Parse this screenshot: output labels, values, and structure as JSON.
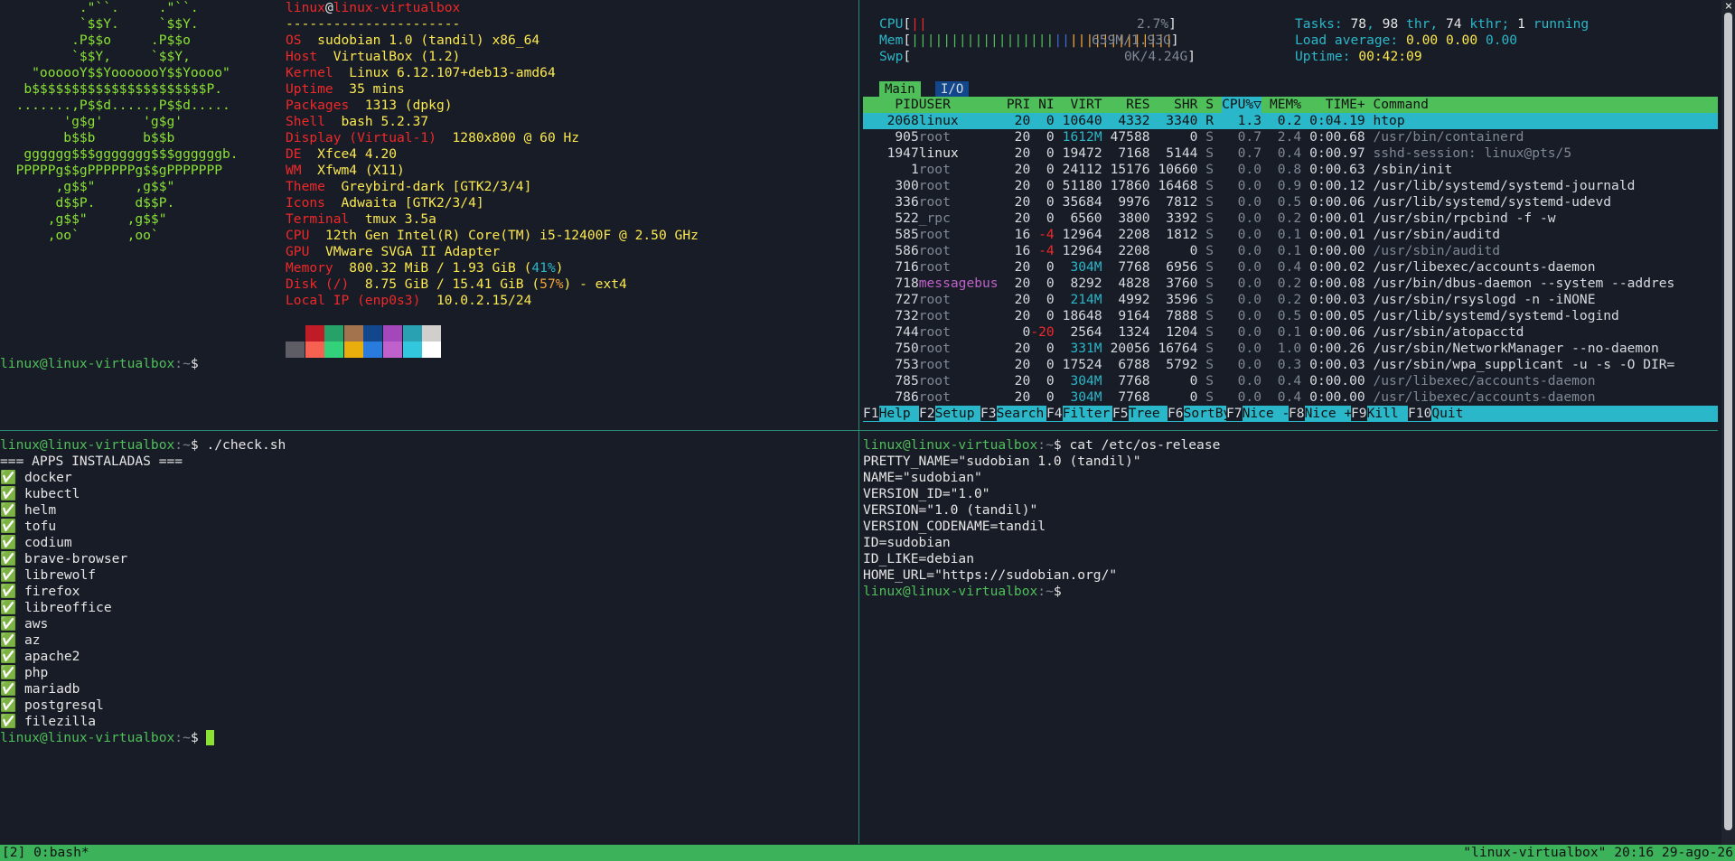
{
  "neofetch": {
    "logo": [
      "          .\"``.     .\"``.",
      "          `$$Y.     `$$Y.",
      "         .P$$o     .P$$o",
      "         `$$Y,     `$$Y,",
      "    \"oooooY$$YooooooY$$Yoooo\"",
      "   b$$$$$$$$$$$$$$$$$$$$$$P.",
      "  .......,P$$d.....,P$$d.....",
      "        'g$g'     'g$g'",
      "        b$$b      b$$b",
      "   gggggg$$$ggggggg$$$ggggggb.",
      "  PPPPPg$$gPPPPPPg$$gPPPPPPP",
      "       ,g$$\"     ,g$$\"",
      "       d$$P.     d$$P.",
      "      ,g$$\"     ,g$$\"",
      "      ,oo`      ,oo`"
    ],
    "user": "linux",
    "at": "@",
    "host": "linux-virtualbox",
    "separator": "----------------------",
    "fields": [
      {
        "key": "OS",
        "value": "sudobian 1.0 (tandil) x86_64"
      },
      {
        "key": "Host",
        "value": "VirtualBox (1.2)"
      },
      {
        "key": "Kernel",
        "value": "Linux 6.12.107+deb13-amd64"
      },
      {
        "key": "Uptime",
        "value": "35 mins"
      },
      {
        "key": "Packages",
        "value": "1313 (dpkg)"
      },
      {
        "key": "Shell",
        "value": "bash 5.2.37"
      },
      {
        "key": "Display (Virtual-1)",
        "value": "1280x800 @ 60 Hz"
      },
      {
        "key": "DE",
        "value": "Xfce4 4.20"
      },
      {
        "key": "WM",
        "value": "Xfwm4 (X11)"
      },
      {
        "key": "Theme",
        "value": "Greybird-dark [GTK2/3/4]"
      },
      {
        "key": "Icons",
        "value": "Adwaita [GTK2/3/4]"
      },
      {
        "key": "Terminal",
        "value": "tmux 3.5a"
      },
      {
        "key": "CPU",
        "value": "12th Gen Intel(R) Core(TM) i5-12400F @ 2.50 GHz"
      },
      {
        "key": "GPU",
        "value": "VMware SVGA II Adapter"
      }
    ],
    "memory_key": "Memory",
    "memory_pre": "800.32 MiB / 1.93 GiB (",
    "memory_pct": "41%",
    "memory_post": ")",
    "disk_key": "Disk (/)",
    "disk_pre": "8.75 GiB / 15.41 GiB (",
    "disk_pct": "57%",
    "disk_post": ") - ext4",
    "ip_key": "Local IP (enp0s3)",
    "ip_value": "10.0.2.15/24",
    "palette_top": [
      "#181c26",
      "#c01c28",
      "#26a269",
      "#a2734c",
      "#12488b",
      "#a347ba",
      "#2aa1b3",
      "#d0cfcc"
    ],
    "palette_bottom": [
      "#5e5c64",
      "#f66151",
      "#33d17a",
      "#e9ad0c",
      "#2a7bde",
      "#c061cb",
      "#33c7de",
      "#ffffff"
    ]
  },
  "prompt": {
    "user_host": "linux@linux-virtualbox",
    "path": ":~",
    "symbol": "$"
  },
  "htop": {
    "cpu_label": "CPU",
    "cpu_bar": "||",
    "cpu_pct": "2.7%",
    "mem_label": "Mem",
    "mem_bar_used": "||||||||||||||||||",
    "mem_bar_buf": "||",
    "mem_bar_cache": "|||||||||||||",
    "mem_value": "659M/1.93G",
    "swp_label": "Swp",
    "swp_value": "0K/4.24G",
    "tasks_label": "Tasks:",
    "tasks_value": "78",
    "thr_value": "98",
    "thr_text": "thr,",
    "kthr_value": "74",
    "kthr_text": "kthr;",
    "running_value": "1",
    "running_text": "running",
    "load_label": "Load average:",
    "load1": "0.00",
    "load5": "0.00",
    "load15": "0.00",
    "uptime_label": "Uptime:",
    "uptime_value": "00:42:09",
    "tabs": [
      "Main",
      "I/O"
    ],
    "columns": [
      "PID",
      "USER",
      "PRI",
      "NI",
      "VIRT",
      "RES",
      "SHR",
      "S",
      "CPU%▽",
      "MEM%",
      "TIME+",
      "Command"
    ],
    "processes": [
      {
        "pid": "2068",
        "user": "linux",
        "pri": "20",
        "ni": "0",
        "virt": "10640",
        "res": "4332",
        "shr": "3340",
        "s": "R",
        "cpu": "1.3",
        "mem": "0.2",
        "time": "0:04.19",
        "cmd": "htop"
      },
      {
        "pid": "905",
        "user": "root",
        "pri": "20",
        "ni": "0",
        "virt": "1612M",
        "res": "47588",
        "shr": "0",
        "s": "S",
        "cpu": "0.7",
        "mem": "2.4",
        "time": "0:00.68",
        "cmd": "/usr/bin/containerd"
      },
      {
        "pid": "1947",
        "user": "linux",
        "pri": "20",
        "ni": "0",
        "virt": "19472",
        "res": "7168",
        "shr": "5144",
        "s": "S",
        "cpu": "0.7",
        "mem": "0.4",
        "time": "0:00.97",
        "cmd": "sshd-session: linux@pts/5"
      },
      {
        "pid": "1",
        "user": "root",
        "pri": "20",
        "ni": "0",
        "virt": "24112",
        "res": "15176",
        "shr": "10660",
        "s": "S",
        "cpu": "0.0",
        "mem": "0.8",
        "time": "0:00.63",
        "cmd": "/sbin/init"
      },
      {
        "pid": "300",
        "user": "root",
        "pri": "20",
        "ni": "0",
        "virt": "51180",
        "res": "17860",
        "shr": "16468",
        "s": "S",
        "cpu": "0.0",
        "mem": "0.9",
        "time": "0:00.12",
        "cmd": "/usr/lib/systemd/systemd-journald"
      },
      {
        "pid": "336",
        "user": "root",
        "pri": "20",
        "ni": "0",
        "virt": "35684",
        "res": "9976",
        "shr": "7812",
        "s": "S",
        "cpu": "0.0",
        "mem": "0.5",
        "time": "0:00.06",
        "cmd": "/usr/lib/systemd/systemd-udevd"
      },
      {
        "pid": "522",
        "user": "_rpc",
        "pri": "20",
        "ni": "0",
        "virt": "6560",
        "res": "3800",
        "shr": "3392",
        "s": "S",
        "cpu": "0.0",
        "mem": "0.2",
        "time": "0:00.01",
        "cmd": "/usr/sbin/rpcbind -f -w"
      },
      {
        "pid": "585",
        "user": "root",
        "pri": "16",
        "ni": "-4",
        "virt": "12964",
        "res": "2208",
        "shr": "1812",
        "s": "S",
        "cpu": "0.0",
        "mem": "0.1",
        "time": "0:00.01",
        "cmd": "/usr/sbin/auditd"
      },
      {
        "pid": "586",
        "user": "root",
        "pri": "16",
        "ni": "-4",
        "virt": "12964",
        "res": "2208",
        "shr": "0",
        "s": "S",
        "cpu": "0.0",
        "mem": "0.1",
        "time": "0:00.00",
        "cmd": "/usr/sbin/auditd"
      },
      {
        "pid": "716",
        "user": "root",
        "pri": "20",
        "ni": "0",
        "virt": "304M",
        "res": "7768",
        "shr": "6956",
        "s": "S",
        "cpu": "0.0",
        "mem": "0.4",
        "time": "0:00.02",
        "cmd": "/usr/libexec/accounts-daemon"
      },
      {
        "pid": "718",
        "user": "messagebus",
        "pri": "20",
        "ni": "0",
        "virt": "8292",
        "res": "4828",
        "shr": "3760",
        "s": "S",
        "cpu": "0.0",
        "mem": "0.2",
        "time": "0:00.08",
        "cmd": "/usr/bin/dbus-daemon --system --addres"
      },
      {
        "pid": "727",
        "user": "root",
        "pri": "20",
        "ni": "0",
        "virt": "214M",
        "res": "4992",
        "shr": "3596",
        "s": "S",
        "cpu": "0.0",
        "mem": "0.2",
        "time": "0:00.03",
        "cmd": "/usr/sbin/rsyslogd -n -iNONE"
      },
      {
        "pid": "732",
        "user": "root",
        "pri": "20",
        "ni": "0",
        "virt": "18648",
        "res": "9164",
        "shr": "7888",
        "s": "S",
        "cpu": "0.0",
        "mem": "0.5",
        "time": "0:00.05",
        "cmd": "/usr/lib/systemd/systemd-logind"
      },
      {
        "pid": "744",
        "user": "root",
        "pri": "0",
        "ni": "-20",
        "virt": "2564",
        "res": "1324",
        "shr": "1204",
        "s": "S",
        "cpu": "0.0",
        "mem": "0.1",
        "time": "0:00.06",
        "cmd": "/usr/sbin/atopacctd"
      },
      {
        "pid": "750",
        "user": "root",
        "pri": "20",
        "ni": "0",
        "virt": "331M",
        "res": "20056",
        "shr": "16764",
        "s": "S",
        "cpu": "0.0",
        "mem": "1.0",
        "time": "0:00.26",
        "cmd": "/usr/sbin/NetworkManager --no-daemon"
      },
      {
        "pid": "753",
        "user": "root",
        "pri": "20",
        "ni": "0",
        "virt": "17524",
        "res": "6788",
        "shr": "5792",
        "s": "S",
        "cpu": "0.0",
        "mem": "0.3",
        "time": "0:00.03",
        "cmd": "/usr/sbin/wpa_supplicant -u -s -O DIR="
      },
      {
        "pid": "785",
        "user": "root",
        "pri": "20",
        "ni": "0",
        "virt": "304M",
        "res": "7768",
        "shr": "0",
        "s": "S",
        "cpu": "0.0",
        "mem": "0.4",
        "time": "0:00.00",
        "cmd": "/usr/libexec/accounts-daemon"
      },
      {
        "pid": "786",
        "user": "root",
        "pri": "20",
        "ni": "0",
        "virt": "304M",
        "res": "7768",
        "shr": "0",
        "s": "S",
        "cpu": "0.0",
        "mem": "0.4",
        "time": "0:00.00",
        "cmd": "/usr/libexec/accounts-daemon"
      }
    ],
    "fkeys": [
      {
        "key": "F1",
        "label": "Help"
      },
      {
        "key": "F2",
        "label": "Setup"
      },
      {
        "key": "F3",
        "label": "Search"
      },
      {
        "key": "F4",
        "label": "Filter"
      },
      {
        "key": "F5",
        "label": "Tree"
      },
      {
        "key": "F6",
        "label": "SortBy"
      },
      {
        "key": "F7",
        "label": "Nice -"
      },
      {
        "key": "F8",
        "label": "Nice +"
      },
      {
        "key": "F9",
        "label": "Kill"
      },
      {
        "key": "F10",
        "label": "Quit"
      }
    ]
  },
  "check": {
    "command": "./check.sh",
    "header": "=== APPS INSTALADAS ===",
    "check_mark": "✅",
    "apps": [
      "docker",
      "kubectl",
      "helm",
      "tofu",
      "codium",
      "brave-browser",
      "librewolf",
      "firefox",
      "libreoffice",
      "aws",
      "az",
      "apache2",
      "php",
      "mariadb",
      "postgresql",
      "filezilla"
    ]
  },
  "osrelease": {
    "command": "cat /etc/os-release",
    "lines": [
      "PRETTY_NAME=\"sudobian 1.0 (tandil)\"",
      "NAME=\"sudobian\"",
      "VERSION_ID=\"1.0\"",
      "VERSION=\"1.0 (tandil)\"",
      "VERSION_CODENAME=tandil",
      "ID=sudobian",
      "ID_LIKE=debian",
      "HOME_URL=\"https://sudobian.org/\""
    ]
  },
  "statusbar": {
    "session": "[2] 0:bash*",
    "right": "\"linux-virtualbox\" 20:16 29-ago-26"
  },
  "close_glyph": "×",
  "colors": {
    "background": "#181c26",
    "prompt": "#8ae234",
    "accent_red": "#ef2929",
    "htop_header": "#4fbf5a",
    "htop_selected": "#2ab7c9",
    "tmux_status": "#3cb25b"
  }
}
